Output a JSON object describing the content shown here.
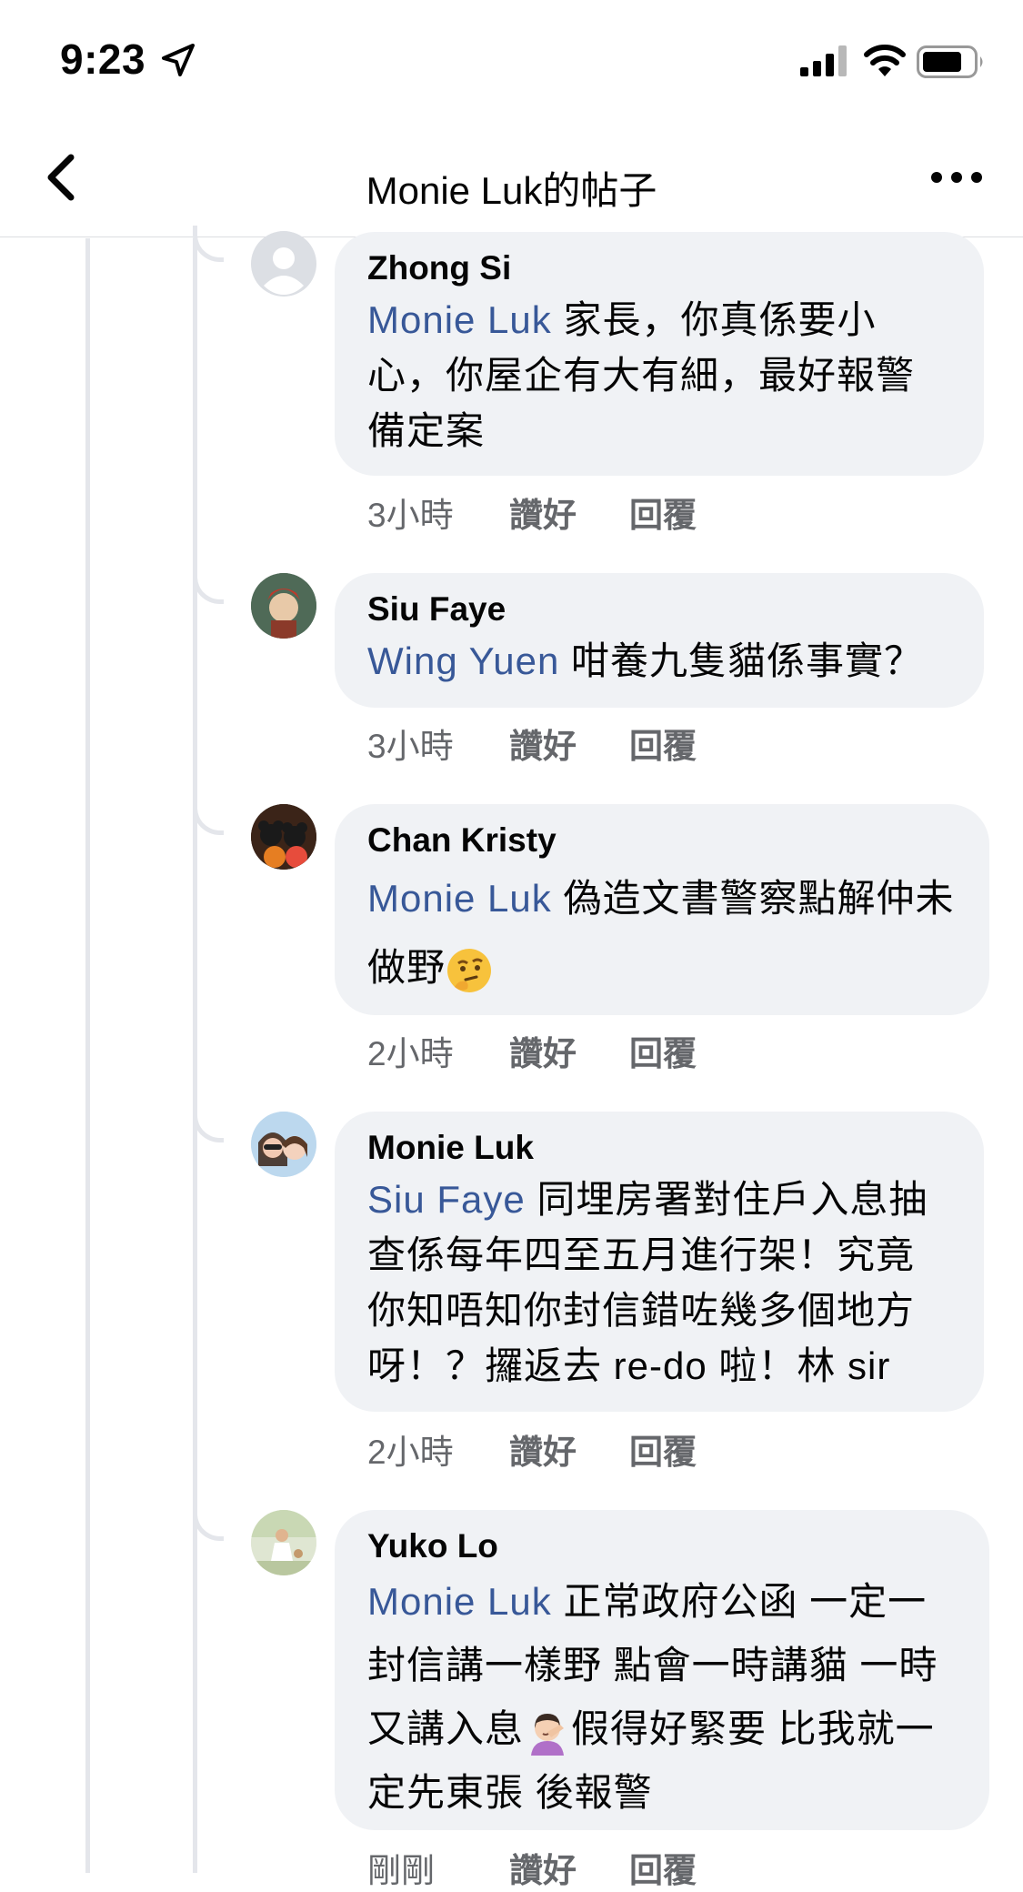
{
  "status": {
    "time": "9:23"
  },
  "nav": {
    "title": "Monie Luk的帖子"
  },
  "comments": [
    {
      "author": "Zhong Si",
      "mention": "Monie Luk",
      "text": " 家長，你真係要小心，你屋企有大有細，最好報警備定案",
      "time": "3小時",
      "like": "讚好",
      "reply": "回覆"
    },
    {
      "author": "Siu Faye",
      "mention": "Wing Yuen",
      "text": " 咁養九隻貓係事實？",
      "time": "3小時",
      "like": "讚好",
      "reply": "回覆"
    },
    {
      "author": "Chan Kristy",
      "mention": "Monie Luk",
      "text": "  偽造文書警察點解仲未做野",
      "emoji": "thinking-face",
      "time": "2小時",
      "like": "讚好",
      "reply": "回覆"
    },
    {
      "author": "Monie Luk",
      "mention": "Siu Faye",
      "text": " 同埋房署對住戶入息抽查係每年四至五月進行架！究竟你知唔知你封信錯咗幾多個地方呀！？攞返去 re-do 啦！林 sir",
      "time": "2小時",
      "like": "讚好",
      "reply": "回覆"
    },
    {
      "author": "Yuko Lo",
      "mention": "Monie Luk",
      "text1": " 正常政府公函 一定一封信講一樣野 點會一時講貓 一時又講入息",
      "emoji": "facepalm",
      "text2": "假得好緊要 比我就一定先東張 後報警",
      "time": "剛剛",
      "like": "讚好",
      "reply": "回覆"
    }
  ],
  "colors": {
    "mention": "#385898",
    "bubble": "#f0f2f5",
    "meta": "#65676b"
  }
}
